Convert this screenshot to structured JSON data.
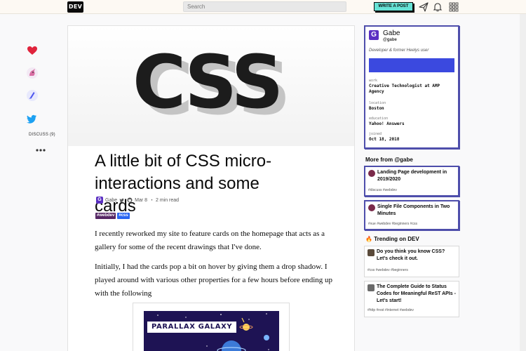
{
  "nav": {
    "logo": "DEV",
    "search_placeholder": "Search",
    "write_post": "WRITE A POST"
  },
  "reactions": {
    "discuss_label": "DISCUSS (9)"
  },
  "article": {
    "cover_text": "CSS",
    "title": "A little bit of CSS micro-interactions and some cards",
    "author": "Gabe",
    "date": "Mar 8",
    "read_time": "・ 2 min read",
    "tags": [
      {
        "label": "#webdev",
        "color": "#562765"
      },
      {
        "label": "#css",
        "color": "#2965f1"
      }
    ],
    "paragraphs": [
      "I recently reworked my site to feature cards on the homepage that acts as a gallery for some of the recent drawings that I've done.",
      "Initially, I had the cards pop a bit on hover by giving them a drop shadow. I played around with various other properties for a few hours before ending up with the following"
    ],
    "figure_label": "PARALLAX GALAXY"
  },
  "profile": {
    "name": "Gabe",
    "handle": "@gabe",
    "bio": "Developer & former Heelys user",
    "work_label": "work",
    "work_value": "Creative Technologist at AMP Agency",
    "location_label": "location",
    "location_value": "Boston",
    "education_label": "education",
    "education_value": "Yahoo! Answers",
    "joined_label": "joined",
    "joined_value": "Oct 18, 2018"
  },
  "more_from": {
    "title": "More from @gabe",
    "items": [
      {
        "title": "Landing Page development in 2019/2020",
        "tags": "#discuss #webdev"
      },
      {
        "title": "Single File Components in Two Minutes",
        "tags": "#vue #webdev #beginners #css"
      }
    ]
  },
  "trending": {
    "title": "Trending on DEV",
    "items": [
      {
        "title": "Do you think you know CSS? Let's check it out.",
        "tags": "#css #webdev #beginners"
      },
      {
        "title": "The Complete Guide to Status Codes for Meaningful ReST APIs - Let's start!",
        "tags": "#http #rest #internet #webdev"
      }
    ]
  },
  "colors": {
    "accent": "#3b49df",
    "write_button": "#66e2d5",
    "card_border": "#4e4eab",
    "heart": "#e0243c",
    "unicorn": "#d96ea3",
    "bookmark": "#4e57ef",
    "twitter": "#1da1f2"
  }
}
